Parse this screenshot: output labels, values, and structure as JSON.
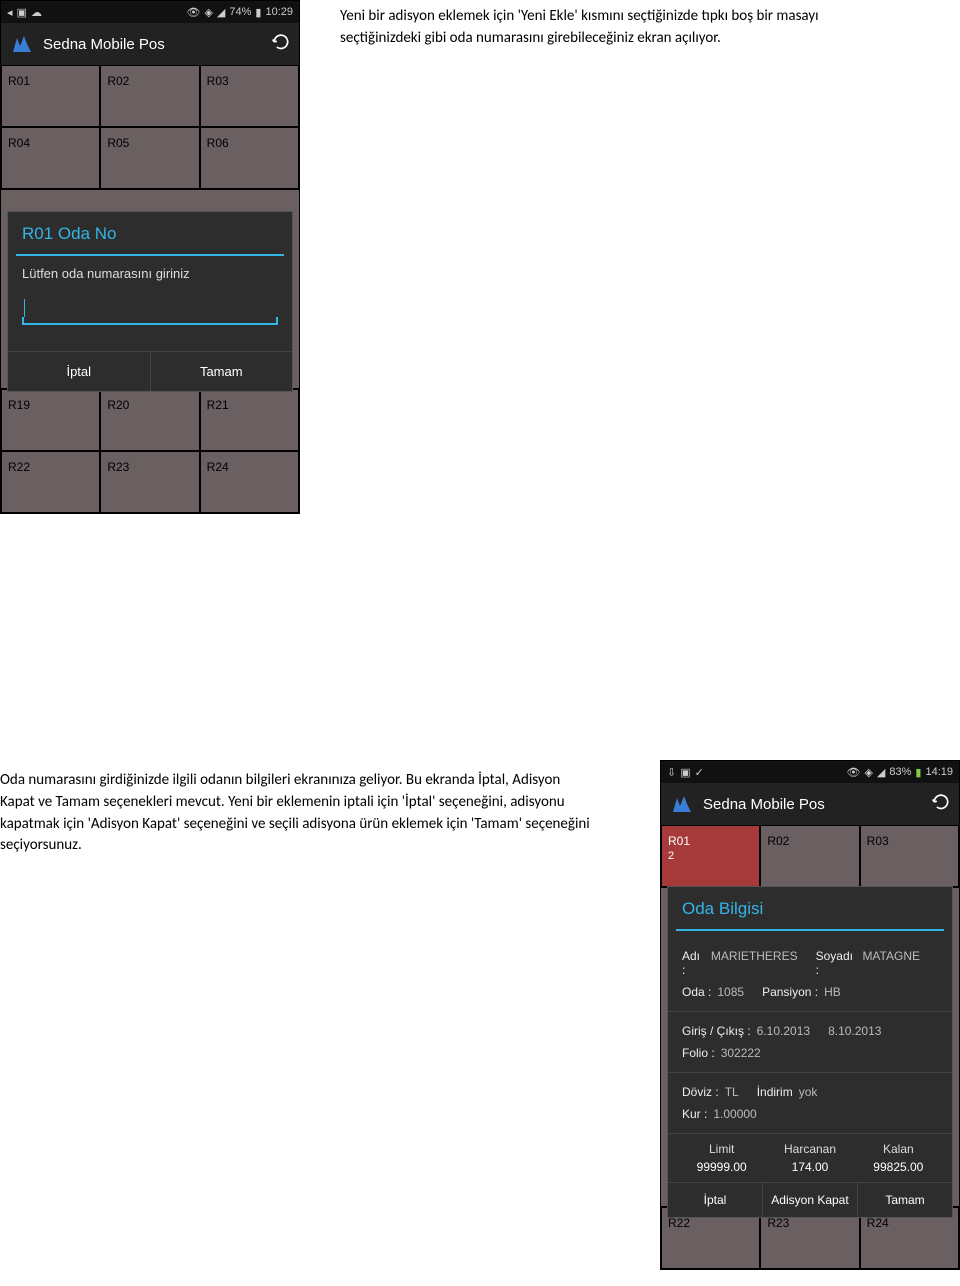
{
  "screenshot1": {
    "status": {
      "battery": "74%",
      "time": "10:29"
    },
    "app_title": "Sedna Mobile Pos",
    "rooms_top": [
      "R01",
      "R02",
      "R03",
      "R04",
      "R05",
      "R06"
    ],
    "rooms_bottom": [
      "R19",
      "R20",
      "R21",
      "R22",
      "R23",
      "R24"
    ],
    "dialog": {
      "title": "R01  Oda No",
      "subtitle": "Lütfen oda numarasını giriniz",
      "btn_cancel": "İptal",
      "btn_ok": "Tamam"
    }
  },
  "paragraph1": "Yeni bir adisyon eklemek için 'Yeni Ekle' kısmını seçtiğinizde tıpkı boş bir masayı seçtiğinizdeki gibi oda numarasını girebileceğiniz ekran açılıyor.",
  "paragraph2": "Oda numarasını girdiğinizde ilgili odanın bilgileri ekranınıza geliyor. Bu ekranda İptal, Adisyon Kapat ve Tamam seçenekleri mevcut. Yeni bir eklemenin iptali için 'İptal' seçeneğini, adisyonu kapatmak için 'Adisyon Kapat' seçeneğini ve seçili adisyona ürün eklemek için 'Tamam' seçeneğini seçiyorsunuz.",
  "screenshot2": {
    "status": {
      "battery": "83%",
      "time": "14:19"
    },
    "app_title": "Sedna Mobile Pos",
    "rooms_top": [
      {
        "label": "R01",
        "count": "2",
        "red": true
      },
      {
        "label": "R02",
        "red": false
      },
      {
        "label": "R03",
        "red": false
      }
    ],
    "rooms_bottom": [
      "R22",
      "R23",
      "R24"
    ],
    "info": {
      "title": "Oda Bilgisi",
      "name_label": "Adı :",
      "name": "MARIETHERES",
      "surname_label": "Soyadı :",
      "surname": "MATAGNE",
      "room_label": "Oda :",
      "room": "1085",
      "board_label": "Pansiyon :",
      "board": "HB",
      "inout_label": "Giriş / Çıkış :",
      "checkin": "6.10.2013",
      "checkout": "8.10.2013",
      "folio_label": "Folio :",
      "folio": "302222",
      "currency_label": "Döviz :",
      "currency": "TL",
      "discount_label": "İndirim",
      "discount": "yok",
      "rate_label": "Kur :",
      "rate": "1.00000",
      "limit_label": "Limit",
      "limit": "99999.00",
      "spent_label": "Harcanan",
      "spent": "174.00",
      "remain_label": "Kalan",
      "remain": "99825.00",
      "btn_cancel": "İptal",
      "btn_close": "Adisyon Kapat",
      "btn_ok": "Tamam"
    }
  }
}
